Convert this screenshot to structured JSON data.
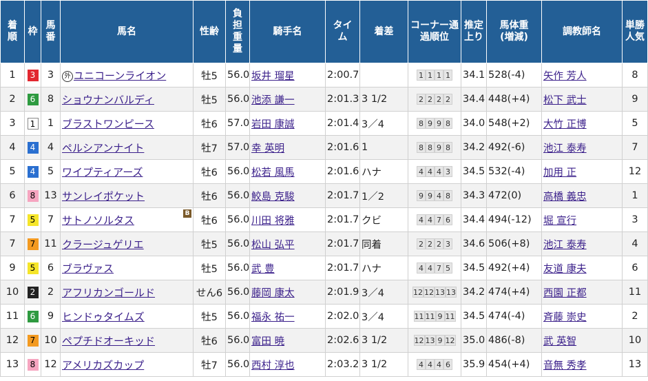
{
  "headers": {
    "rank": "着順",
    "waku": "枠",
    "umaban": "馬番",
    "horse": "馬名",
    "sexage": "性齢",
    "weight": "負担重量",
    "jockey": "騎手名",
    "time": "タイム",
    "margin": "着差",
    "corner": "コーナー通過順位",
    "last3f": "推定上り",
    "bodyweight": "馬体重(増減)",
    "trainer": "調教師名",
    "pop": "単勝人気"
  },
  "rows": [
    {
      "rank": "1",
      "waku": "3",
      "umaban": "3",
      "gaiji": "外",
      "horse": "ユニコーンライオン",
      "blinker": "",
      "sexage": "牡5",
      "weight": "56.0",
      "jockey": "坂井 瑠星",
      "time": "2:00.7",
      "margin": "",
      "corner": [
        "1",
        "1",
        "1",
        "1"
      ],
      "last3f": "34.1",
      "bodyweight": "528(-4)",
      "trainer": "矢作 芳人",
      "pop": "8"
    },
    {
      "rank": "2",
      "waku": "6",
      "umaban": "8",
      "gaiji": "",
      "horse": "ショウナンバルディ",
      "blinker": "",
      "sexage": "牡5",
      "weight": "56.0",
      "jockey": "池添 謙一",
      "time": "2:01.3",
      "margin": "3 1/2",
      "corner": [
        "2",
        "2",
        "2",
        "2"
      ],
      "last3f": "34.4",
      "bodyweight": "448(+4)",
      "trainer": "松下 武士",
      "pop": "9"
    },
    {
      "rank": "3",
      "waku": "1",
      "umaban": "1",
      "gaiji": "",
      "horse": "ブラストワンピース",
      "blinker": "",
      "sexage": "牡6",
      "weight": "57.0",
      "jockey": "岩田 康誠",
      "time": "2:01.4",
      "margin": "3／4",
      "corner": [
        "8",
        "9",
        "9",
        "8"
      ],
      "last3f": "34.0",
      "bodyweight": "548(+2)",
      "trainer": "大竹 正博",
      "pop": "5"
    },
    {
      "rank": "4",
      "waku": "4",
      "umaban": "4",
      "gaiji": "",
      "horse": "ペルシアンナイト",
      "blinker": "",
      "sexage": "牡7",
      "weight": "57.0",
      "jockey": "幸 英明",
      "time": "2:01.6",
      "margin": "1",
      "corner": [
        "8",
        "8",
        "9",
        "8"
      ],
      "last3f": "34.2",
      "bodyweight": "492(-6)",
      "trainer": "池江 泰寿",
      "pop": "7"
    },
    {
      "rank": "5",
      "waku": "4",
      "umaban": "5",
      "gaiji": "",
      "horse": "ワイプティアーズ",
      "blinker": "",
      "sexage": "牡6",
      "weight": "56.0",
      "jockey": "松若 風馬",
      "time": "2:01.6",
      "margin": "ハナ",
      "corner": [
        "4",
        "4",
        "4",
        "3"
      ],
      "last3f": "34.5",
      "bodyweight": "532(-4)",
      "trainer": "加用 正",
      "pop": "12"
    },
    {
      "rank": "6",
      "waku": "8",
      "umaban": "13",
      "gaiji": "",
      "horse": "サンレイポケット",
      "blinker": "",
      "sexage": "牡6",
      "weight": "56.0",
      "jockey": "鮫島 克駿",
      "time": "2:01.7",
      "margin": "1／2",
      "corner": [
        "9",
        "9",
        "4",
        "8"
      ],
      "last3f": "34.3",
      "bodyweight": "472(0)",
      "trainer": "高橋 義忠",
      "pop": "1"
    },
    {
      "rank": "7",
      "waku": "5",
      "umaban": "7",
      "gaiji": "",
      "horse": "サトノソルタス",
      "blinker": "B",
      "sexage": "牡6",
      "weight": "56.0",
      "jockey": "川田 将雅",
      "time": "2:01.7",
      "margin": "クビ",
      "corner": [
        "4",
        "4",
        "7",
        "6"
      ],
      "last3f": "34.4",
      "bodyweight": "494(-12)",
      "trainer": "堀 宣行",
      "pop": "3"
    },
    {
      "rank": "7",
      "waku": "7",
      "umaban": "11",
      "gaiji": "",
      "horse": "クラージュゲリエ",
      "blinker": "",
      "sexage": "牡5",
      "weight": "56.0",
      "jockey": "松山 弘平",
      "time": "2:01.7",
      "margin": "同着",
      "corner": [
        "2",
        "2",
        "2",
        "3"
      ],
      "last3f": "34.6",
      "bodyweight": "506(+8)",
      "trainer": "池江 泰寿",
      "pop": "4"
    },
    {
      "rank": "9",
      "waku": "5",
      "umaban": "6",
      "gaiji": "",
      "horse": "ブラヴァス",
      "blinker": "",
      "sexage": "牡5",
      "weight": "56.0",
      "jockey": "武 豊",
      "time": "2:01.7",
      "margin": "ハナ",
      "corner": [
        "4",
        "4",
        "7",
        "5"
      ],
      "last3f": "34.5",
      "bodyweight": "492(+4)",
      "trainer": "友道 康夫",
      "pop": "6"
    },
    {
      "rank": "10",
      "waku": "2",
      "umaban": "2",
      "gaiji": "",
      "horse": "アフリカンゴールド",
      "blinker": "",
      "sexage": "せん6",
      "weight": "56.0",
      "jockey": "藤岡 康太",
      "time": "2:01.9",
      "margin": "3／4",
      "corner": [
        "12",
        "12",
        "13",
        "13"
      ],
      "last3f": "34.2",
      "bodyweight": "474(+4)",
      "trainer": "西園 正都",
      "pop": "11"
    },
    {
      "rank": "11",
      "waku": "6",
      "umaban": "9",
      "gaiji": "",
      "horse": "ヒンドゥタイムズ",
      "blinker": "",
      "sexage": "牡5",
      "weight": "56.0",
      "jockey": "福永 祐一",
      "time": "2:02.0",
      "margin": "3／4",
      "corner": [
        "11",
        "11",
        "9",
        "11"
      ],
      "last3f": "34.5",
      "bodyweight": "474(-4)",
      "trainer": "斉藤 崇史",
      "pop": "2"
    },
    {
      "rank": "12",
      "waku": "7",
      "umaban": "10",
      "gaiji": "",
      "horse": "ペプチドオーキッド",
      "blinker": "",
      "sexage": "牡6",
      "weight": "56.0",
      "jockey": "富田 暁",
      "time": "2:02.6",
      "margin": "3 1/2",
      "corner": [
        "12",
        "13",
        "9",
        "12"
      ],
      "last3f": "35.0",
      "bodyweight": "486(-8)",
      "trainer": "武 英智",
      "pop": "10"
    },
    {
      "rank": "13",
      "waku": "8",
      "umaban": "12",
      "gaiji": "",
      "horse": "アメリカズカップ",
      "blinker": "",
      "sexage": "牡7",
      "weight": "56.0",
      "jockey": "西村 淳也",
      "time": "2:03.2",
      "margin": "3 1/2",
      "corner": [
        "4",
        "4",
        "4",
        "6"
      ],
      "last3f": "35.9",
      "bodyweight": "454(+4)",
      "trainer": "音無 秀孝",
      "pop": "13"
    }
  ]
}
